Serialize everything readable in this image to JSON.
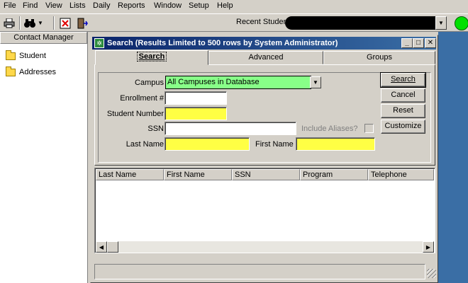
{
  "menu": [
    "File",
    "Find",
    "View",
    "Lists",
    "Daily",
    "Reports",
    "Window",
    "Setup",
    "Help"
  ],
  "toolbar": {
    "recent_label": "Recent Studen",
    "icons": [
      "printer-icon",
      "binoculars-icon",
      "dropdown-arrow-icon",
      "close-record-icon",
      "exit-door-icon"
    ]
  },
  "left_panel": {
    "header": "Contact Manager",
    "items": [
      "Student",
      "Addresses"
    ]
  },
  "window": {
    "title": "Search  (Results Limited to 500 rows by System Administrator)",
    "buttons": {
      "minimize": "_",
      "maximize": "□",
      "close": "✕"
    }
  },
  "tabs": [
    "Search",
    "Advanced",
    "Groups"
  ],
  "form": {
    "campus_label": "Campus",
    "campus_value": "All Campuses in Database",
    "enrollment_label": "Enrollment #",
    "enrollment_value": "",
    "student_number_label": "Student Number",
    "student_number_value": "",
    "ssn_label": "SSN",
    "ssn_value": "",
    "include_aliases_label": "Include Aliases?",
    "include_aliases_checked": false,
    "last_name_label": "Last Name",
    "last_name_value": "",
    "first_name_label": "First Name",
    "first_name_value": ""
  },
  "actions": {
    "search": "Search",
    "cancel": "Cancel",
    "reset": "Reset",
    "customize": "Customize"
  },
  "grid": {
    "columns": [
      "Last Name",
      "First Name",
      "SSN",
      "Program",
      "Telephone"
    ],
    "rows": []
  },
  "colors": {
    "required_field": "#ffff44",
    "campus_field": "#88ff88",
    "titlebar": "#0a246a",
    "status_light": "#00e000",
    "desktop": "#3a6ea5"
  }
}
